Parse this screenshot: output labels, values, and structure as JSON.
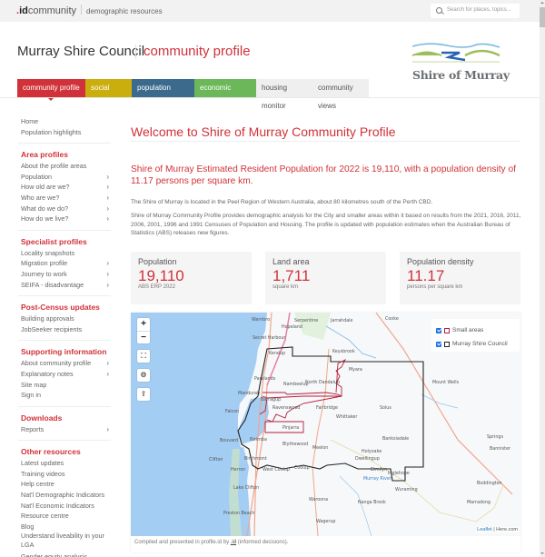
{
  "topbar": {
    "brand_dot": ".",
    "brand_id": "id",
    "brand_rest": "community",
    "tagline": "demographic resources",
    "search_placeholder": "Search for places, topics..."
  },
  "header": {
    "council": "Murray Shire Council",
    "product": "community profile",
    "logo_text": "Shire of Murray"
  },
  "tabs": [
    {
      "label": "community profile",
      "active": true,
      "color": "#d13239"
    },
    {
      "label": "social atlas",
      "color": "#c9ae0e"
    },
    {
      "label": "population forecast",
      "color": "#3c6a8c"
    },
    {
      "label": "economic profile",
      "color": "#6cb75a"
    },
    {
      "label": "housing monitor",
      "color": "#efefef"
    },
    {
      "label": "community views",
      "color": "#efefef"
    }
  ],
  "sidebar": {
    "top": [
      "Home",
      "Population highlights"
    ],
    "sections": [
      {
        "title": "Area profiles",
        "items": [
          {
            "label": "About the profile areas",
            "chevron": false
          },
          {
            "label": "Population",
            "chevron": true
          },
          {
            "label": "How old are we?",
            "chevron": true
          },
          {
            "label": "Who are we?",
            "chevron": true
          },
          {
            "label": "What do we do?",
            "chevron": true
          },
          {
            "label": "How do we live?",
            "chevron": true
          }
        ]
      },
      {
        "title": "Specialist profiles",
        "items": [
          {
            "label": "Locality snapshots",
            "chevron": false
          },
          {
            "label": "Migration profile",
            "chevron": true
          },
          {
            "label": "Journey to work",
            "chevron": true
          },
          {
            "label": "SEIFA - disadvantage",
            "chevron": true
          }
        ]
      },
      {
        "title": "Post-Census updates",
        "items": [
          {
            "label": "Building approvals",
            "chevron": false
          },
          {
            "label": "JobSeeker recipients",
            "chevron": false
          }
        ]
      },
      {
        "title": "Supporting information",
        "items": [
          {
            "label": "About community profile",
            "chevron": true
          },
          {
            "label": "Explanatory notes",
            "chevron": true
          },
          {
            "label": "Site map",
            "chevron": false
          },
          {
            "label": "Sign in",
            "chevron": false
          }
        ]
      },
      {
        "title": "Downloads",
        "items": [
          {
            "label": "Reports",
            "chevron": true
          }
        ]
      },
      {
        "title": "Other resources",
        "items": [
          {
            "label": "Latest updates",
            "chevron": false
          },
          {
            "label": "Training videos",
            "chevron": false
          },
          {
            "label": "Help centre",
            "chevron": false
          },
          {
            "label": "Nat'l Demographic Indicators",
            "chevron": false
          },
          {
            "label": "Nat'l Economic Indicators",
            "chevron": false
          },
          {
            "label": "Resource centre",
            "chevron": false
          },
          {
            "label": "Blog",
            "chevron": false
          },
          {
            "label": "Understand liveability in your LGA",
            "chevron": false
          },
          {
            "label": "Gender equity analysis",
            "chevron": false
          }
        ]
      }
    ]
  },
  "main": {
    "title": "Welcome to Shire of Murray Community Profile",
    "lead": "Shire of Murray Estimated Resident Population for 2022 is 19,110, with a population density of 11.17 persons per square km.",
    "para1": "The Shire of Murray is located in the Peel Region of Western Australia, about 80 kilometres south of the Perth CBD.",
    "para2": "Shire of Murray Community Profile provides demographic analysis for the City and smaller areas within it based on results from the 2021, 2016, 2011, 2006, 2001, 1996 and 1991 Censuses of Population and Housing. The profile is updated with population estimates when the Australian Bureau of Statistics (ABS) releases new figures.",
    "cards": [
      {
        "label": "Population",
        "value": "19,110",
        "sub": "ABS ERP 2022"
      },
      {
        "label": "Land area",
        "value": "1,711",
        "sub": "square km"
      },
      {
        "label": "Population density",
        "value": "11.17",
        "sub": "persons per square km"
      }
    ]
  },
  "map": {
    "controls": {
      "zoom_in": "+",
      "zoom_out": "−",
      "fullscreen": "⛶",
      "settings": "⚙",
      "share": "⇪"
    },
    "legend": [
      {
        "label": "Small areas",
        "checked": true,
        "color": "#b51e3b"
      },
      {
        "label": "Murray Shire Council",
        "checked": true,
        "color": "#222222"
      }
    ],
    "attribution_leaflet": "Leaflet",
    "attribution_rest": " | Here.com",
    "credit_prefix": "Compiled and presented in profile.id by ",
    "credit_link": ".id",
    "credit_suffix": " (informed decisions).",
    "places": [
      "Warnbro",
      "Hopeland",
      "Serpentine",
      "Jarrahdale",
      "Cooke",
      "Secret Harbour",
      "Keralup",
      "Keysbrook",
      "Myara",
      "Parklands",
      "Nambeelup",
      "North Dandalup",
      "Mount Wells",
      "Mandurah",
      "Barragup",
      "Ravenswood",
      "Fairbridge",
      "Whittaker",
      "Solus",
      "Springs",
      "Falcon",
      "Pinjarra",
      "Nirimba",
      "Blythewood",
      "Meelon",
      "Banksiadale",
      "Bannister",
      "Bouvard",
      "Clifton",
      "Birchmont",
      "Holyoake",
      "Herron",
      "West Coolup",
      "Coolup",
      "Dwellingup",
      "Etmilyn",
      "Inglehope",
      "Lake Clifton",
      "Murray River",
      "Wuraming",
      "Boddington",
      "Waroona",
      "Preston Beach",
      "Nanga Brook",
      "Marradong",
      "Wagerup"
    ]
  }
}
